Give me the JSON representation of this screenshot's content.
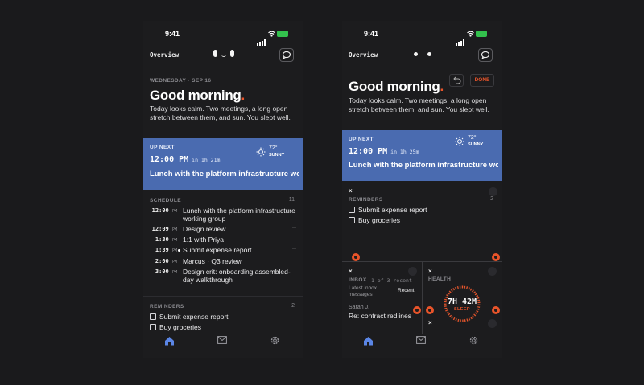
{
  "status": {
    "time": "9:41",
    "battery": ""
  },
  "header": {
    "title": "Overview"
  },
  "left": {
    "date": "WEDNESDAY · SEP 16",
    "greeting": "Good morning",
    "summary": "Today looks calm. Two meetings, a long open stretch between them, and sun. You slept well.",
    "up_next": {
      "label": "UP NEXT",
      "time": "12:00 PM",
      "relative": "in 1h 21m",
      "title": "Lunch with the platform infrastructure working group",
      "temp": "72°",
      "condition": "SUNNY"
    },
    "schedule": {
      "label": "SCHEDULE",
      "count": "11",
      "items": [
        {
          "time": "12:00",
          "ampm": "PM",
          "title": "Lunch with the platform infrastructure working group"
        },
        {
          "time": "12:09",
          "ampm": "PM",
          "title": "Design review"
        },
        {
          "time": "1:30",
          "ampm": "PM",
          "title": "1:1 with Priya"
        },
        {
          "time": "1:39",
          "ampm": "PM",
          "title": "Submit expense report"
        },
        {
          "time": "2:00",
          "ampm": "PM",
          "title": "Marcus · Q3 review"
        },
        {
          "time": "3:00",
          "ampm": "PM",
          "title": "Design crit: onboarding assembled-day walkthrough"
        }
      ]
    },
    "reminders": {
      "label": "REMINDERS",
      "count": "2",
      "items": [
        "Submit expense report",
        "Buy groceries"
      ]
    }
  },
  "right": {
    "greeting": "Good morning",
    "done_label": "DONE",
    "summary": "Today looks calm. Two meetings, a long open stretch between them, and sun. You slept well.",
    "up_next": {
      "label": "UP NEXT",
      "time": "12:00 PM",
      "relative": "in 1h 25m",
      "title": "Lunch with the platform infrastructure working group",
      "temp": "72°",
      "condition": "SUNNY"
    },
    "reminders": {
      "label": "REMINDERS",
      "count": "2",
      "items": [
        "Submit expense report",
        "Buy groceries"
      ]
    },
    "inbox": {
      "label": "INBOX",
      "count": "1 of 3 recent",
      "subtitle": "Latest inbox messages",
      "filter": "Recent",
      "sender": "Sarah J.",
      "subject": "Re: contract redlines"
    },
    "health": {
      "label": "HEALTH",
      "value": "7H 42M",
      "caption": "SLEEP"
    }
  },
  "colors": {
    "accent": "#4a6bb0",
    "orange": "#e8542a",
    "bg": "#1c1c1e"
  }
}
